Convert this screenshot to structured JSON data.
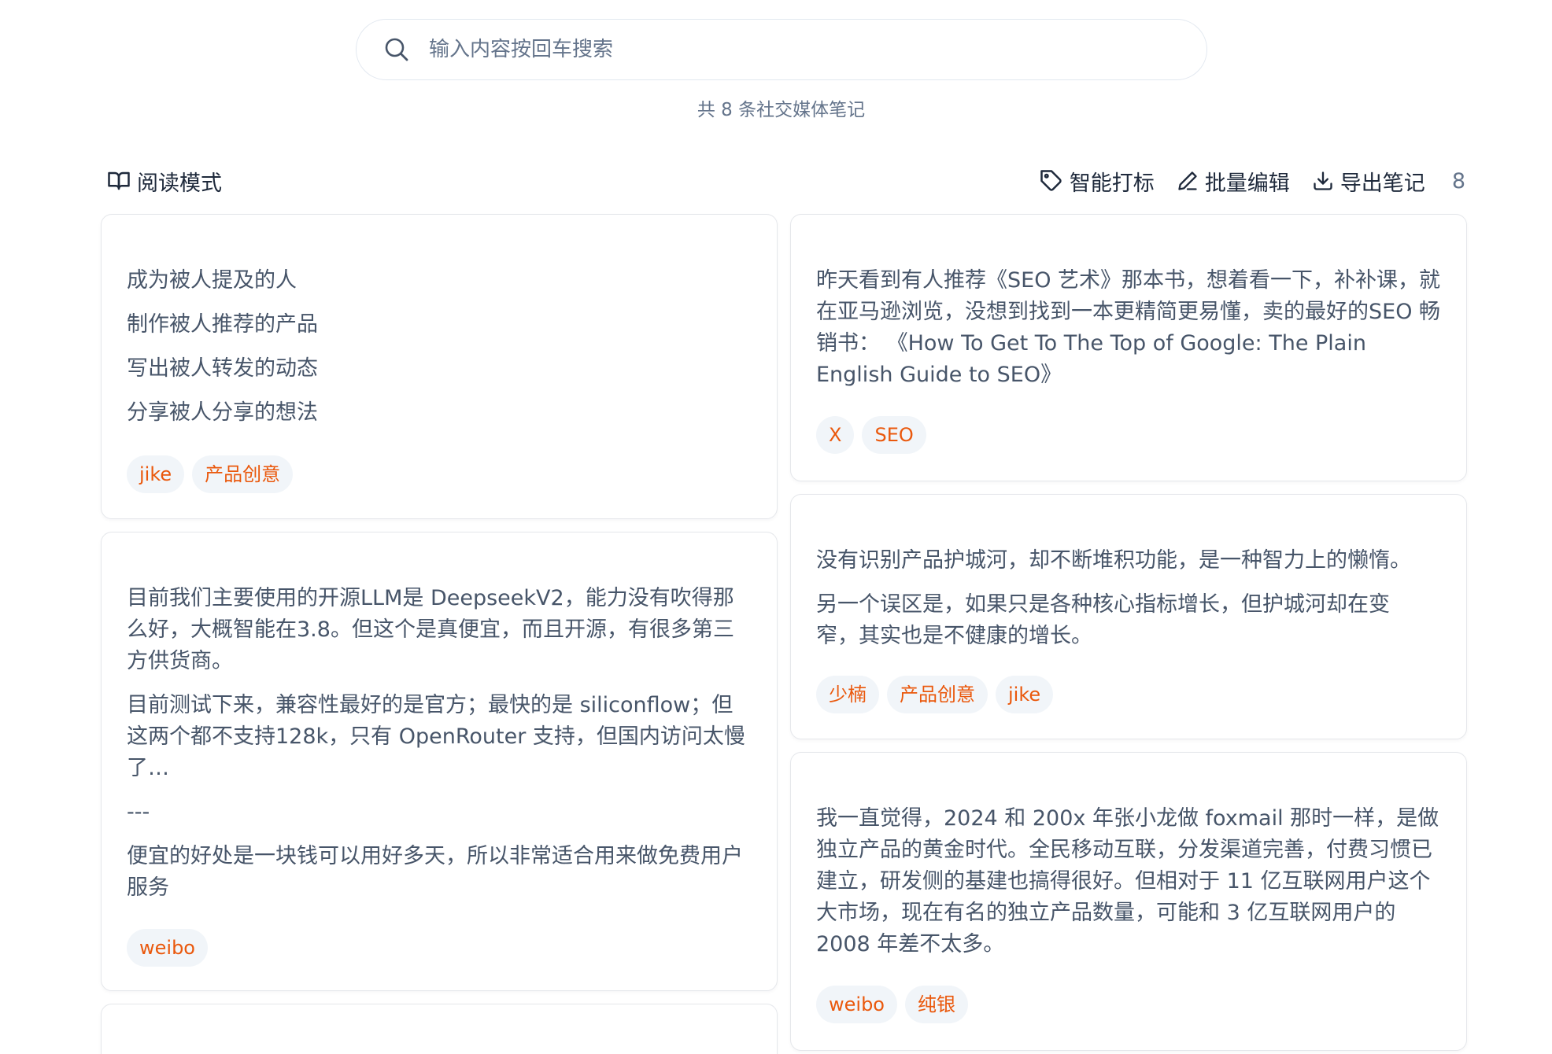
{
  "search": {
    "placeholder": "输入内容按回车搜索",
    "summary": "共 8 条社交媒体笔记"
  },
  "toolbar": {
    "reading_mode": "阅读模式",
    "smart_tag": "智能打标",
    "batch_edit": "批量编辑",
    "export_notes": "导出笔记",
    "count": "8"
  },
  "colors": {
    "tag_text": "#ea580c",
    "tag_bg": "#f1f5f9",
    "card_border": "#e5e7eb",
    "body_text": "#475569"
  },
  "notes": [
    {
      "paragraphs": [
        "成为被人提及的人",
        "制作被人推荐的产品",
        "写出被人转发的动态",
        "分享被人分享的想法"
      ],
      "tags": [
        "jike",
        "产品创意"
      ]
    },
    {
      "paragraphs": [
        "昨天看到有人推荐《SEO 艺术》那本书，想着看一下，补补课，就在亚马逊浏览，没想到找到一本更精简更易懂，卖的最好的SEO 畅销书： 《How To Get To The Top of Google: The Plain English Guide to SEO》"
      ],
      "tags": [
        "X",
        "SEO"
      ]
    },
    {
      "paragraphs": [
        "目前我们主要使用的开源LLM是 DeepseekV2，能力没有吹得那么好，大概智能在3.8。但这个是真便宜，而且开源，有很多第三方供货商。",
        "目前测试下来，兼容性最好的是官方；最快的是 siliconflow；但这两个都不支持128k，只有 OpenRouter 支持，但国内访问太慢了…",
        "---",
        "便宜的好处是一块钱可以用好多天，所以非常适合用来做免费用户服务"
      ],
      "tags": [
        "weibo"
      ]
    },
    {
      "paragraphs": [
        "没有识别产品护城河，却不断堆积功能，是一种智力上的懒惰。",
        "另一个误区是，如果只是各种核心指标增长，但护城河却在变窄，其实也是不健康的增长。"
      ],
      "tags": [
        "少楠",
        "产品创意",
        "jike"
      ]
    },
    {
      "paragraphs": [
        "我一直觉得，2024 和 200x 年张小龙做 foxmail 那时一样，是做独立产品的黄金时代。全民移动互联，分发渠道完善，付费习惯已建立，研发侧的基建也搞得很好。但相对于 11 亿互联网用户这个大市场，现在有名的独立产品数量，可能和 3 亿互联网用户的 2008 年差不太多。"
      ],
      "tags": [
        "weibo",
        "纯银"
      ]
    }
  ]
}
